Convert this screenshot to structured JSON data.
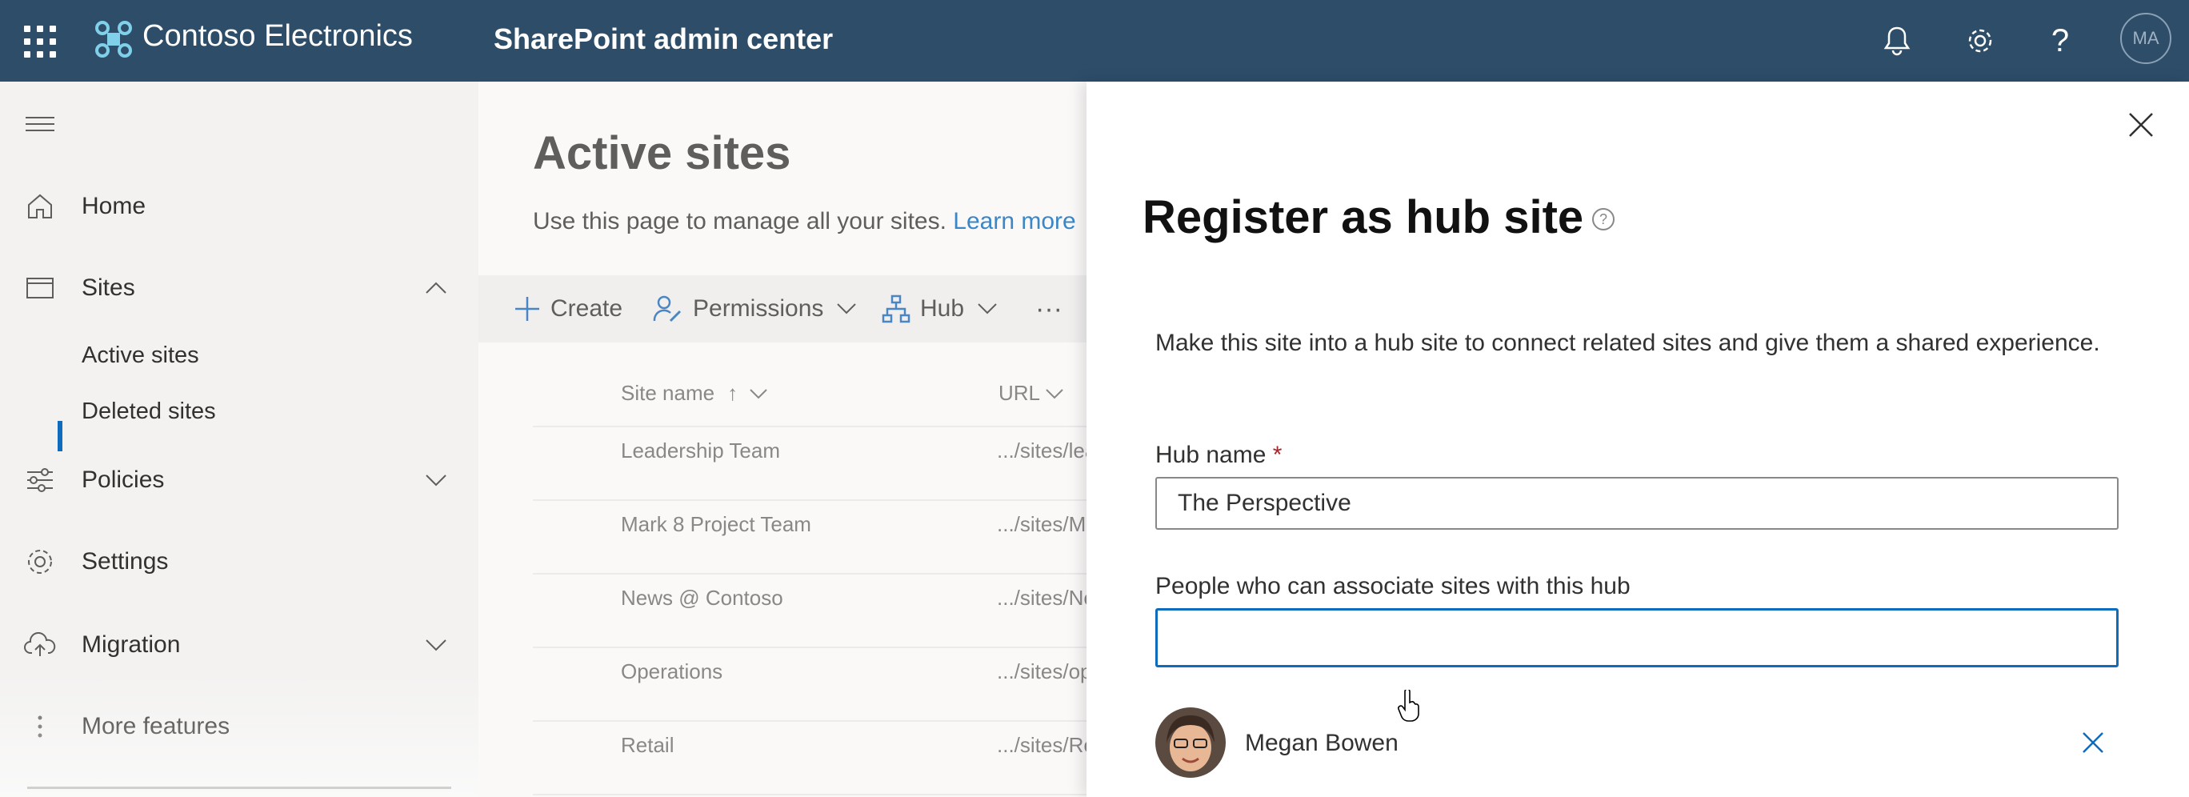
{
  "topbar": {
    "brand": "Contoso Electronics",
    "app_name": "SharePoint admin center",
    "avatar_initials": "MA",
    "icons": [
      "app-launcher-icon",
      "notifications-bell-icon",
      "settings-gear-icon",
      "help-icon"
    ]
  },
  "nav": {
    "items": [
      {
        "label": "Home",
        "icon": "home-icon"
      },
      {
        "label": "Sites",
        "icon": "sites-icon",
        "expanded": true
      },
      {
        "label": "Policies",
        "icon": "policies-icon"
      },
      {
        "label": "Settings",
        "icon": "settings-icon"
      },
      {
        "label": "Migration",
        "icon": "migration-icon"
      },
      {
        "label": "More features",
        "icon": "more-icon"
      }
    ],
    "subitems": [
      {
        "label": "Active sites",
        "selected": true
      },
      {
        "label": "Deleted sites"
      }
    ]
  },
  "main": {
    "title": "Active sites",
    "description": "Use this page to manage all your sites.",
    "learn_more": "Learn more",
    "commands": {
      "create": "Create",
      "permissions": "Permissions",
      "hub": "Hub",
      "more": "···"
    },
    "columns": {
      "site_name": "Site name",
      "sort_arrow": "↑",
      "url": "URL"
    },
    "rows": [
      {
        "name": "Leadership Team",
        "url": ".../sites/lea"
      },
      {
        "name": "Mark 8 Project Team",
        "url": ".../sites/M"
      },
      {
        "name": "News @ Contoso",
        "url": ".../sites/Ne"
      },
      {
        "name": "Operations",
        "url": ".../sites/op"
      },
      {
        "name": "Retail",
        "url": ".../sites/Re"
      }
    ]
  },
  "panel": {
    "title": "Register as hub site",
    "help_glyph": "?",
    "description": "Make this site into a hub site to connect related sites and give them a shared experience.",
    "hub_name_label": "Hub name",
    "required_mark": "*",
    "hub_name_value": "The Perspective",
    "people_label": "People who can associate sites with this hub",
    "people_input_value": "",
    "person": {
      "name": "Megan Bowen"
    }
  },
  "colors": {
    "topbar": "#2d4d69",
    "accent": "#0f6cbd",
    "required": "#a4262c",
    "link": "#3a86c7"
  }
}
